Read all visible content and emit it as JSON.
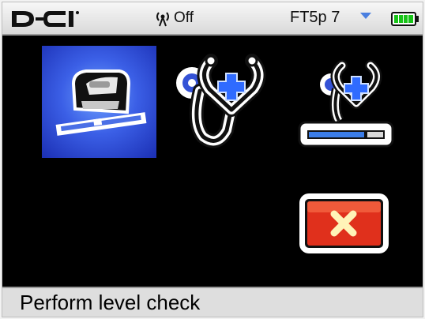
{
  "status_bar": {
    "logo_text": "D-C-I",
    "signal_label": "Off",
    "frequency_label": "FT5p 7",
    "battery_color": "#18c418"
  },
  "menu": {
    "items": [
      {
        "name": "level-check",
        "icon": "locator-on-level-icon",
        "selected": true
      },
      {
        "name": "diagnostics",
        "icon": "stethoscope-icon",
        "selected": false
      },
      {
        "name": "level-diagnostics",
        "icon": "stethoscope-level-icon",
        "selected": false
      },
      {
        "name": "exit",
        "icon": "close-icon",
        "selected": false
      }
    ],
    "selected_color": "#3b5fe6",
    "exit_color": "#e0301c"
  },
  "hint": {
    "text": "Perform level check"
  }
}
